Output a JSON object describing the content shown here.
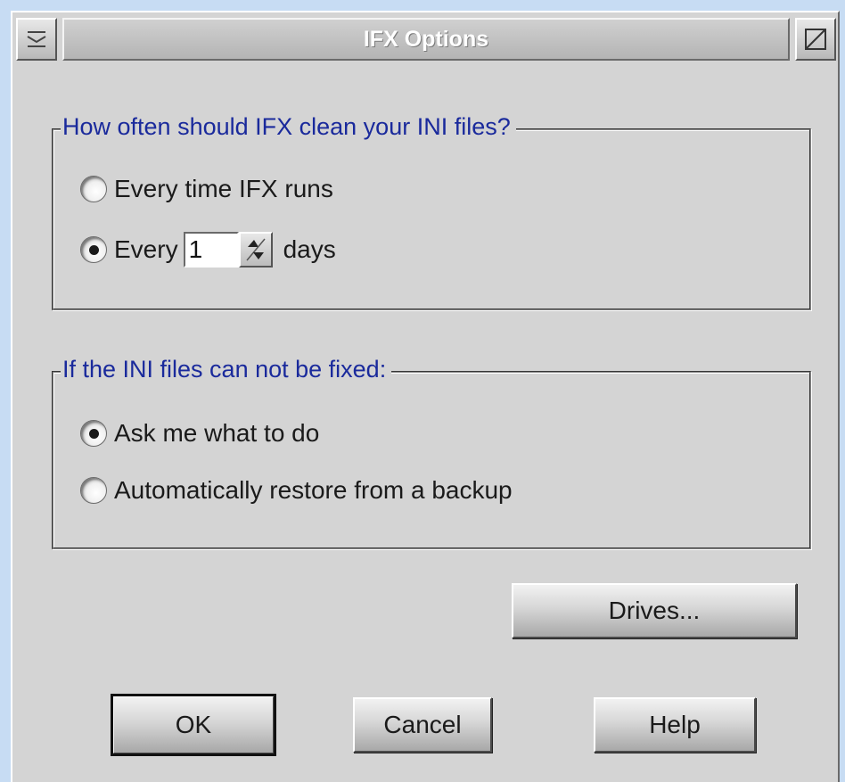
{
  "window": {
    "title": "IFX Options",
    "sysmenu_icon": "sysmenu-icon",
    "maximize_icon": "maximize-icon"
  },
  "group_clean": {
    "legend": "How often should IFX clean your INI files?",
    "option_every_time": "Every time IFX runs",
    "option_every_prefix": "Every",
    "days_value": "1",
    "days_suffix": "days",
    "selected": "every_n_days"
  },
  "group_fix": {
    "legend": "If the INI files can not be fixed:",
    "option_ask": "Ask me what to do",
    "option_restore": "Automatically restore from a backup",
    "selected": "ask"
  },
  "buttons": {
    "drives": "Drives...",
    "ok": "OK",
    "cancel": "Cancel",
    "help": "Help"
  },
  "colors": {
    "background": "#c7dcf3",
    "dialog": "#d4d4d4",
    "legend_text": "#1a2a9c"
  }
}
